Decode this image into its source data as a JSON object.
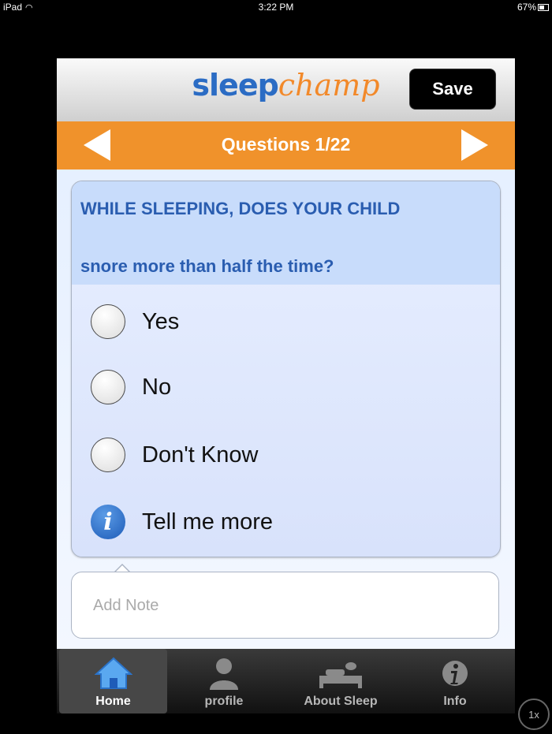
{
  "status_bar": {
    "device": "iPad",
    "time": "3:22 PM",
    "battery": "67%"
  },
  "header": {
    "logo_part1": "sleep",
    "logo_part2": "champ",
    "save_label": "Save"
  },
  "question_bar": {
    "title": "Questions  1/22",
    "prev_icon": "left-arrow-icon",
    "next_icon": "right-arrow-icon"
  },
  "question": {
    "main": "WHILE SLEEPING, DOES YOUR CHILD",
    "sub": "snore more than half the time?",
    "options": [
      {
        "label": "Yes",
        "selected": false
      },
      {
        "label": "No",
        "selected": false
      },
      {
        "label": "Don't Know",
        "selected": false
      }
    ],
    "info_label": "Tell me more"
  },
  "note": {
    "placeholder": "Add Note",
    "value": ""
  },
  "tabbar": {
    "items": [
      {
        "label": "Home",
        "icon": "home-icon",
        "active": true
      },
      {
        "label": "profile",
        "icon": "profile-icon",
        "active": false
      },
      {
        "label": "About Sleep",
        "icon": "sleep-bed-icon",
        "active": false
      },
      {
        "label": "Info",
        "icon": "info-icon",
        "active": false
      }
    ]
  },
  "zoom_button": "1x",
  "colors": {
    "orange_bar": "#f0922b",
    "logo_blue": "#2b6cc4",
    "logo_orange": "#f2892a",
    "question_text": "#2a5db0"
  }
}
